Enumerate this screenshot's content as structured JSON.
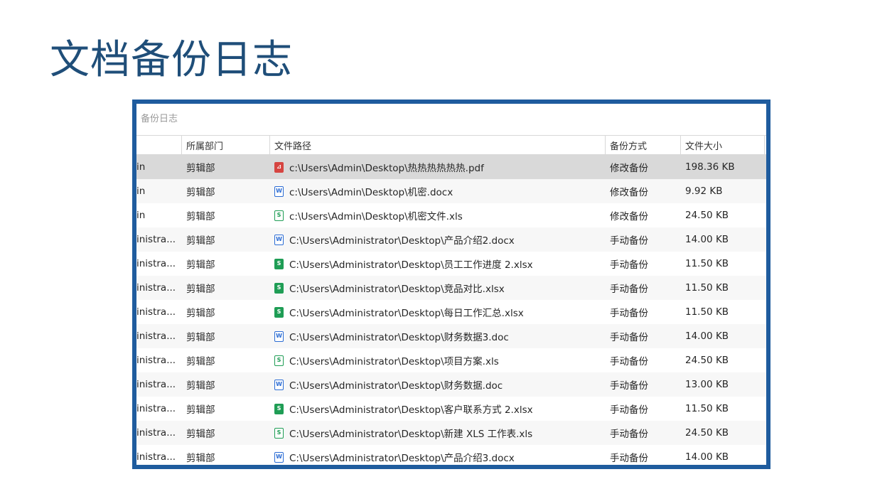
{
  "slide": {
    "title": "文档备份日志"
  },
  "panel": {
    "title": "备份日志"
  },
  "table": {
    "columns": [
      "",
      "所属部门",
      "文件路径",
      "备份方式",
      "文件大小"
    ],
    "rows": [
      {
        "user": "in",
        "dept": "剪辑部",
        "icon": "pdf-file-icon",
        "path": "c:\\Users\\Admin\\Desktop\\热热热热热热.pdf",
        "mode": "修改备份",
        "size": "198.36 KB"
      },
      {
        "user": "in",
        "dept": "剪辑部",
        "icon": "word-file-icon",
        "path": "c:\\Users\\Admin\\Desktop\\机密.docx",
        "mode": "修改备份",
        "size": "9.92 KB"
      },
      {
        "user": "in",
        "dept": "剪辑部",
        "icon": "excel-file-icon",
        "path": "c:\\Users\\Admin\\Desktop\\机密文件.xls",
        "mode": "修改备份",
        "size": "24.50 KB"
      },
      {
        "user": "inistra...",
        "dept": "剪辑部",
        "icon": "word-file-icon",
        "path": "C:\\Users\\Administrator\\Desktop\\产品介绍2.docx",
        "mode": "手动备份",
        "size": "14.00 KB"
      },
      {
        "user": "inistra...",
        "dept": "剪辑部",
        "icon": "excel-file-icon",
        "path": "C:\\Users\\Administrator\\Desktop\\员工工作进度 2.xlsx",
        "mode": "手动备份",
        "size": "11.50 KB"
      },
      {
        "user": "inistra...",
        "dept": "剪辑部",
        "icon": "excel-file-icon",
        "path": "C:\\Users\\Administrator\\Desktop\\竞品对比.xlsx",
        "mode": "手动备份",
        "size": "11.50 KB"
      },
      {
        "user": "inistra...",
        "dept": "剪辑部",
        "icon": "excel-file-icon",
        "path": "C:\\Users\\Administrator\\Desktop\\每日工作汇总.xlsx",
        "mode": "手动备份",
        "size": "11.50 KB"
      },
      {
        "user": "inistra...",
        "dept": "剪辑部",
        "icon": "word-file-icon",
        "path": "C:\\Users\\Administrator\\Desktop\\财务数据3.doc",
        "mode": "手动备份",
        "size": "14.00 KB"
      },
      {
        "user": "inistra...",
        "dept": "剪辑部",
        "icon": "excel-file-icon",
        "path": "C:\\Users\\Administrator\\Desktop\\项目方案.xls",
        "mode": "手动备份",
        "size": "24.50 KB"
      },
      {
        "user": "inistra...",
        "dept": "剪辑部",
        "icon": "word-file-icon",
        "path": "C:\\Users\\Administrator\\Desktop\\财务数据.doc",
        "mode": "手动备份",
        "size": "13.00 KB"
      },
      {
        "user": "inistra...",
        "dept": "剪辑部",
        "icon": "excel-file-icon",
        "path": "C:\\Users\\Administrator\\Desktop\\客户联系方式 2.xlsx",
        "mode": "手动备份",
        "size": "11.50 KB"
      },
      {
        "user": "inistra...",
        "dept": "剪辑部",
        "icon": "excel-file-icon",
        "path": "C:\\Users\\Administrator\\Desktop\\新建 XLS 工作表.xls",
        "mode": "手动备份",
        "size": "24.50 KB"
      },
      {
        "user": "inistra...",
        "dept": "剪辑部",
        "icon": "word-file-icon",
        "path": "C:\\Users\\Administrator\\Desktop\\产品介绍3.docx",
        "mode": "手动备份",
        "size": "14.00 KB"
      }
    ]
  },
  "colors": {
    "frame": "#1f5c9e",
    "title": "#1f4e79",
    "selected_row": "#d9d9d9"
  }
}
